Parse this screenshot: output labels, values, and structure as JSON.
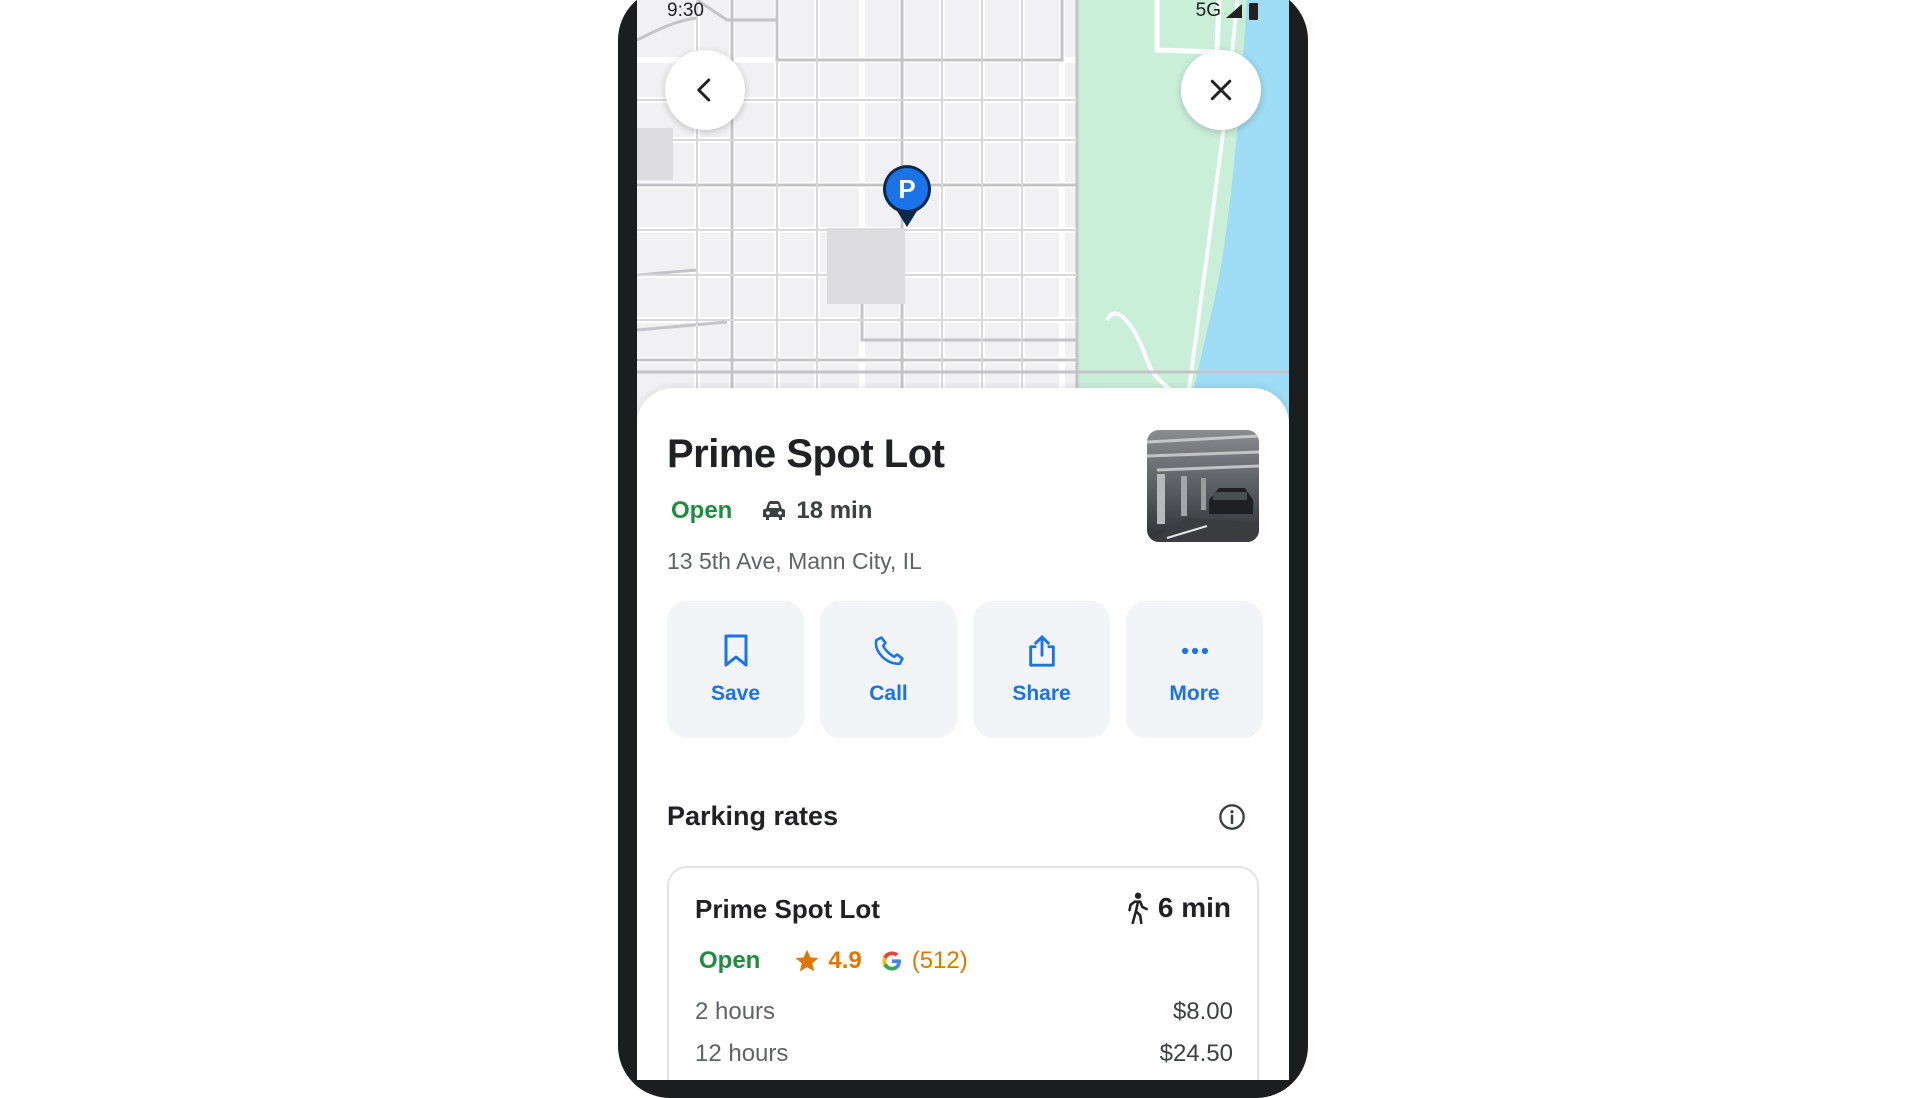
{
  "status_bar": {
    "time": "9:30",
    "network": "5G"
  },
  "nav": {
    "back_icon": "chevron-left-icon",
    "close_icon": "close-icon"
  },
  "map": {
    "pin_letter": "P",
    "pin_color": "#1a73e8",
    "park_color": "#c9efd9",
    "water_color": "#9fdcf5"
  },
  "place": {
    "name": "Prime Spot Lot",
    "status": "Open",
    "drive_time": "18 min",
    "address": "13 5th Ave, Mann City, IL"
  },
  "actions": [
    {
      "label": "Save",
      "icon": "bookmark-icon"
    },
    {
      "label": "Call",
      "icon": "phone-icon"
    },
    {
      "label": "Share",
      "icon": "share-icon"
    },
    {
      "label": "More",
      "icon": "more-dots-icon"
    }
  ],
  "parking_rates": {
    "title": "Parking rates",
    "lot": {
      "name": "Prime Spot Lot",
      "walk_time": "6 min",
      "status": "Open",
      "rating": "4.9",
      "review_count": "(512)",
      "rates": [
        {
          "duration": "2 hours",
          "price": "$8.00"
        },
        {
          "duration": "12 hours",
          "price": "$24.50"
        }
      ]
    }
  },
  "colors": {
    "accent": "#1a73e8",
    "open": "#1e8e3e",
    "rating": "#e37400"
  }
}
